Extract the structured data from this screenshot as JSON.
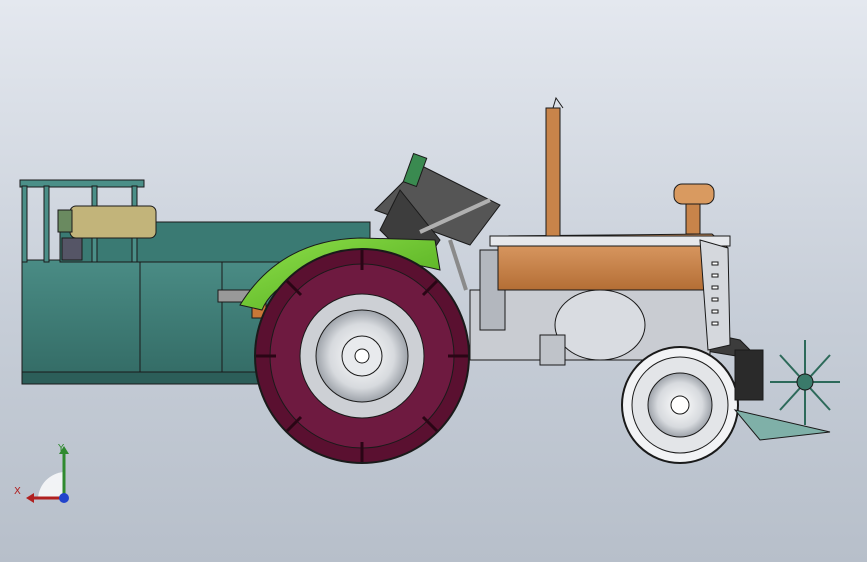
{
  "viewport": {
    "background_top": "#e4e8ef",
    "background_bottom": "#b7bfca"
  },
  "model": {
    "colors": {
      "trailer": "#3f7f78",
      "trailer_dark": "#2c5e59",
      "fender": "#6fcf2a",
      "hood": "#c8844a",
      "tire": "#5a1030",
      "chassis": "#c9ccd2",
      "conveyor": "#4a4a4a",
      "outline": "#1a1a1a"
    },
    "icons": [
      "cad-model",
      "coordinate-triad"
    ]
  },
  "triad": {
    "y_label": "Y",
    "x_label": "X",
    "y_color": "#2f8a2f",
    "x_color": "#b02020",
    "origin_color": "#2244cc"
  }
}
